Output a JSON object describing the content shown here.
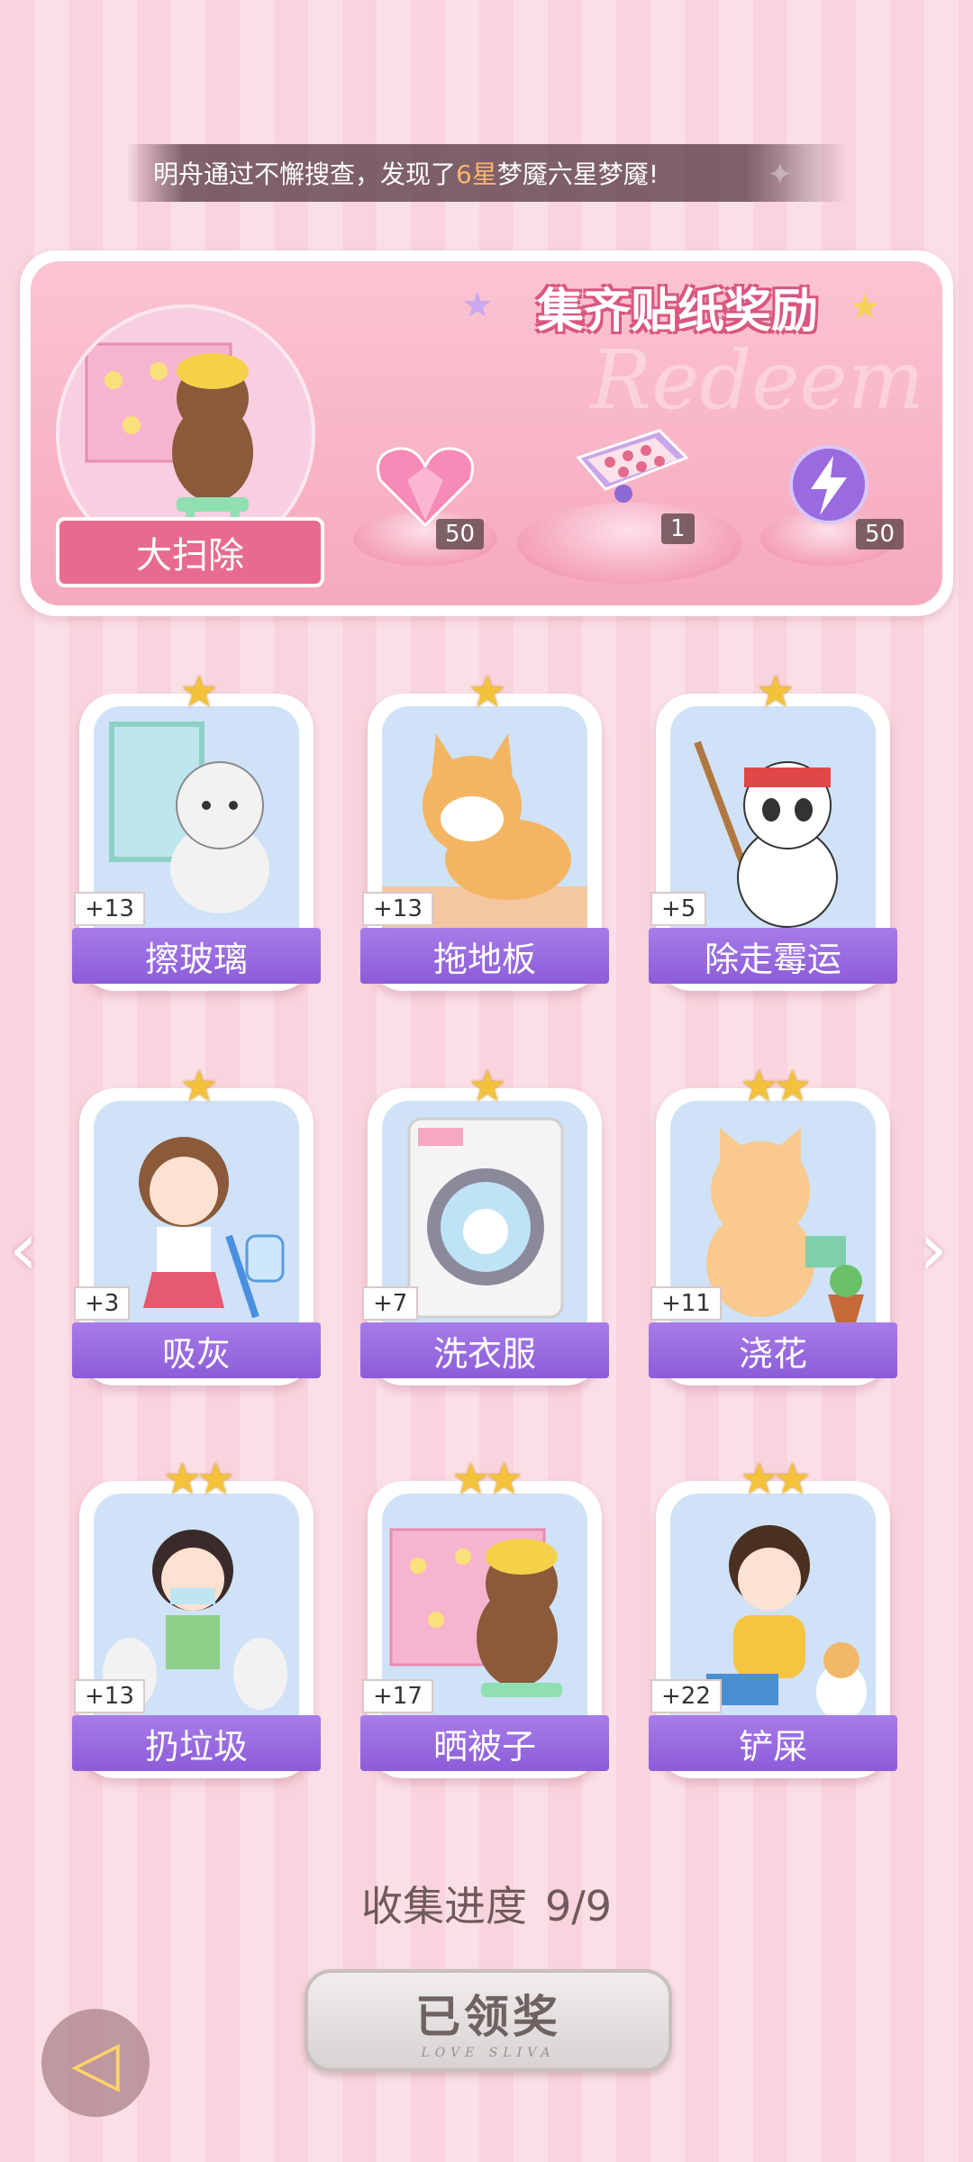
{
  "notice": {
    "prefix": "明舟通过不懈搜查，发现了",
    "highlight": "6星",
    "suffix": "梦魇六星梦魇!"
  },
  "panel": {
    "title": "集齐贴纸奖励",
    "watermark": "Redeem",
    "theme_name": "大扫除",
    "rewards": [
      {
        "icon": "heart-gem-icon",
        "count": "50"
      },
      {
        "icon": "gift-box-icon",
        "count": "1"
      },
      {
        "icon": "lightning-orb-icon",
        "count": "50"
      }
    ]
  },
  "cards": [
    {
      "label": "擦玻璃",
      "plus": "+13",
      "stars": "★",
      "icon": "cat-cleaning-window"
    },
    {
      "label": "拖地板",
      "plus": "+13",
      "stars": "★",
      "icon": "corgi-mopping"
    },
    {
      "label": "除走霉运",
      "plus": "+5",
      "stars": "★",
      "icon": "panda-sweeping"
    },
    {
      "label": "吸灰",
      "plus": "+3",
      "stars": "★",
      "icon": "girl-vacuuming"
    },
    {
      "label": "洗衣服",
      "plus": "+7",
      "stars": "★",
      "icon": "washing-machine"
    },
    {
      "label": "浇花",
      "plus": "+11",
      "stars": "★★",
      "icon": "cat-watering"
    },
    {
      "label": "扔垃圾",
      "plus": "+13",
      "stars": "★★",
      "icon": "girl-trash"
    },
    {
      "label": "晒被子",
      "plus": "+17",
      "stars": "★★",
      "icon": "bear-quilt"
    },
    {
      "label": "铲屎",
      "plus": "+22",
      "stars": "★★",
      "icon": "girl-litter"
    }
  ],
  "progress": {
    "label": "收集进度",
    "value": "9/9"
  },
  "claim": {
    "label": "已领奖",
    "sub": "LOVE SLIVA"
  },
  "colors": {
    "label_purple": "#8c5cd8",
    "panel_pink": "#f6a9bd",
    "star_gold": "#f3c23a"
  }
}
